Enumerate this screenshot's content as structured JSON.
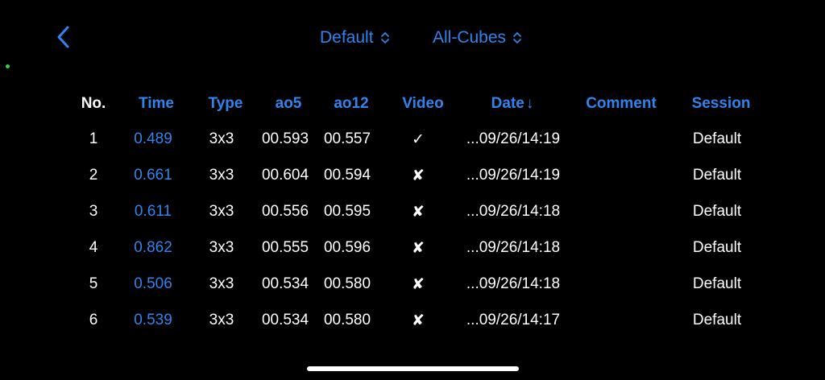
{
  "nav": {
    "back_icon": "chevron-left-icon",
    "session_picker": {
      "label": "Default",
      "icon": "up-down-chevron-icon"
    },
    "puzzle_picker": {
      "label": "All-Cubes",
      "icon": "up-down-chevron-icon"
    }
  },
  "colors": {
    "accent": "#2f84ee",
    "background": "#000000",
    "text": "#ffffff",
    "status_dot": "#30d158"
  },
  "table": {
    "headers": {
      "no": "No.",
      "time": "Time",
      "type": "Type",
      "ao5": "ao5",
      "ao12": "ao12",
      "video": "Video",
      "date": "Date",
      "date_sort_icon": "↓",
      "comment": "Comment",
      "session": "Session"
    },
    "rows": [
      {
        "no": "1",
        "time": "0.489",
        "type": "3x3",
        "ao5": "00.593",
        "ao12": "00.557",
        "video": "✓",
        "date": "...09/26/14:19",
        "comment": "",
        "session": "Default"
      },
      {
        "no": "2",
        "time": "0.661",
        "type": "3x3",
        "ao5": "00.604",
        "ao12": "00.594",
        "video": "✘",
        "date": "...09/26/14:19",
        "comment": "",
        "session": "Default"
      },
      {
        "no": "3",
        "time": "0.611",
        "type": "3x3",
        "ao5": "00.556",
        "ao12": "00.595",
        "video": "✘",
        "date": "...09/26/14:18",
        "comment": "",
        "session": "Default"
      },
      {
        "no": "4",
        "time": "0.862",
        "type": "3x3",
        "ao5": "00.555",
        "ao12": "00.596",
        "video": "✘",
        "date": "...09/26/14:18",
        "comment": "",
        "session": "Default"
      },
      {
        "no": "5",
        "time": "0.506",
        "type": "3x3",
        "ao5": "00.534",
        "ao12": "00.580",
        "video": "✘",
        "date": "...09/26/14:18",
        "comment": "",
        "session": "Default"
      },
      {
        "no": "6",
        "time": "0.539",
        "type": "3x3",
        "ao5": "00.534",
        "ao12": "00.580",
        "video": "✘",
        "date": "...09/26/14:17",
        "comment": "",
        "session": "Default"
      }
    ]
  }
}
